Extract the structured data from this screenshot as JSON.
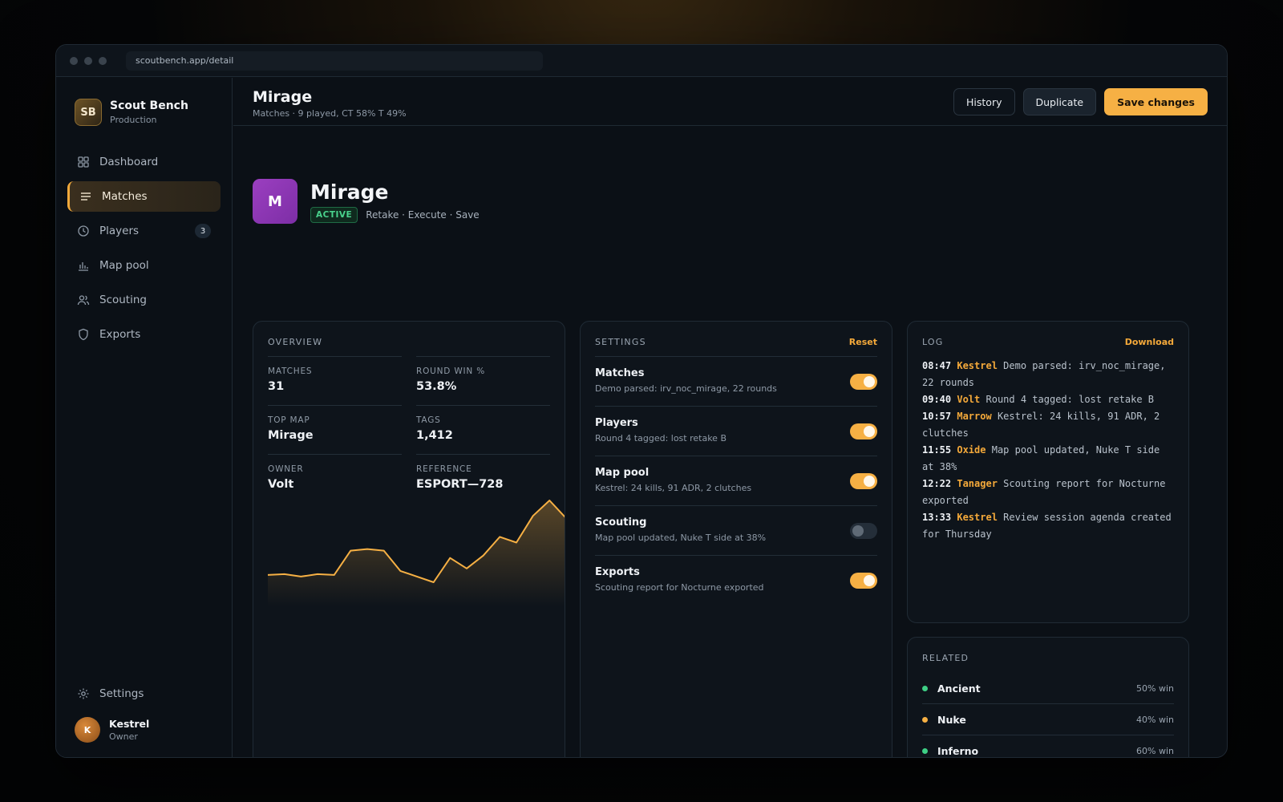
{
  "window": {
    "url": "scoutbench.app/detail"
  },
  "brand": {
    "initials": "SB",
    "name": "Scout Bench",
    "env": "Production"
  },
  "nav": {
    "items": [
      {
        "label": "Dashboard"
      },
      {
        "label": "Matches"
      },
      {
        "label": "Players",
        "badge": "3"
      },
      {
        "label": "Map pool"
      },
      {
        "label": "Scouting"
      },
      {
        "label": "Exports"
      }
    ],
    "settings_label": "Settings"
  },
  "user": {
    "initial": "K",
    "name": "Kestrel",
    "role": "Owner"
  },
  "topbar": {
    "title": "Mirage",
    "subtitle": "Matches · 9 played, CT 58% T 49%",
    "history_label": "History",
    "duplicate_label": "Duplicate",
    "save_label": "Save changes"
  },
  "hero": {
    "initial": "M",
    "title": "Mirage",
    "status": "ACTIVE",
    "tags": "Retake · Execute · Save"
  },
  "overview": {
    "heading": "OVERVIEW",
    "stats": [
      {
        "label": "MATCHES",
        "value": "31"
      },
      {
        "label": "ROUND WIN %",
        "value": "53.8%"
      },
      {
        "label": "TOP MAP",
        "value": "Mirage"
      },
      {
        "label": "TAGS",
        "value": "1,412"
      },
      {
        "label": "OWNER",
        "value": "Volt"
      },
      {
        "label": "REFERENCE",
        "value": "ESPORT—728"
      }
    ]
  },
  "chart_data": {
    "type": "area",
    "values": [
      10,
      11,
      8,
      11,
      10,
      40,
      42,
      40,
      15,
      8,
      1,
      31,
      18,
      34,
      57,
      50,
      83,
      102,
      80
    ],
    "color": "#f6b044"
  },
  "settings": {
    "heading": "SETTINGS",
    "reset_label": "Reset",
    "rows": [
      {
        "title": "Matches",
        "desc": "Demo parsed: irv_noc_mirage, 22 rounds",
        "on": true
      },
      {
        "title": "Players",
        "desc": "Round 4 tagged: lost retake B",
        "on": true
      },
      {
        "title": "Map pool",
        "desc": "Kestrel: 24 kills, 91 ADR, 2 clutches",
        "on": true
      },
      {
        "title": "Scouting",
        "desc": "Map pool updated, Nuke T side at 38%",
        "on": false
      },
      {
        "title": "Exports",
        "desc": "Scouting report for Nocturne exported",
        "on": true
      }
    ]
  },
  "log": {
    "heading": "LOG",
    "download_label": "Download",
    "entries": [
      {
        "time": "08:47",
        "user": "Kestrel",
        "text": "Demo parsed: irv_noc_mirage, 22 rounds"
      },
      {
        "time": "09:40",
        "user": "Volt",
        "text": "Round 4 tagged: lost retake B"
      },
      {
        "time": "10:57",
        "user": "Marrow",
        "text": "Kestrel: 24 kills, 91 ADR, 2 clutches"
      },
      {
        "time": "11:55",
        "user": "Oxide",
        "text": "Map pool updated, Nuke T side at 38%"
      },
      {
        "time": "12:22",
        "user": "Tanager",
        "text": "Scouting report for Nocturne exported"
      },
      {
        "time": "13:33",
        "user": "Kestrel",
        "text": "Review session agenda created for Thursday"
      }
    ]
  },
  "related": {
    "heading": "RELATED",
    "items": [
      {
        "name": "Ancient",
        "value": "50% win",
        "color": "#3ecf85"
      },
      {
        "name": "Nuke",
        "value": "40% win",
        "color": "#f6b044"
      },
      {
        "name": "Inferno",
        "value": "60% win",
        "color": "#3ecf85"
      }
    ]
  }
}
